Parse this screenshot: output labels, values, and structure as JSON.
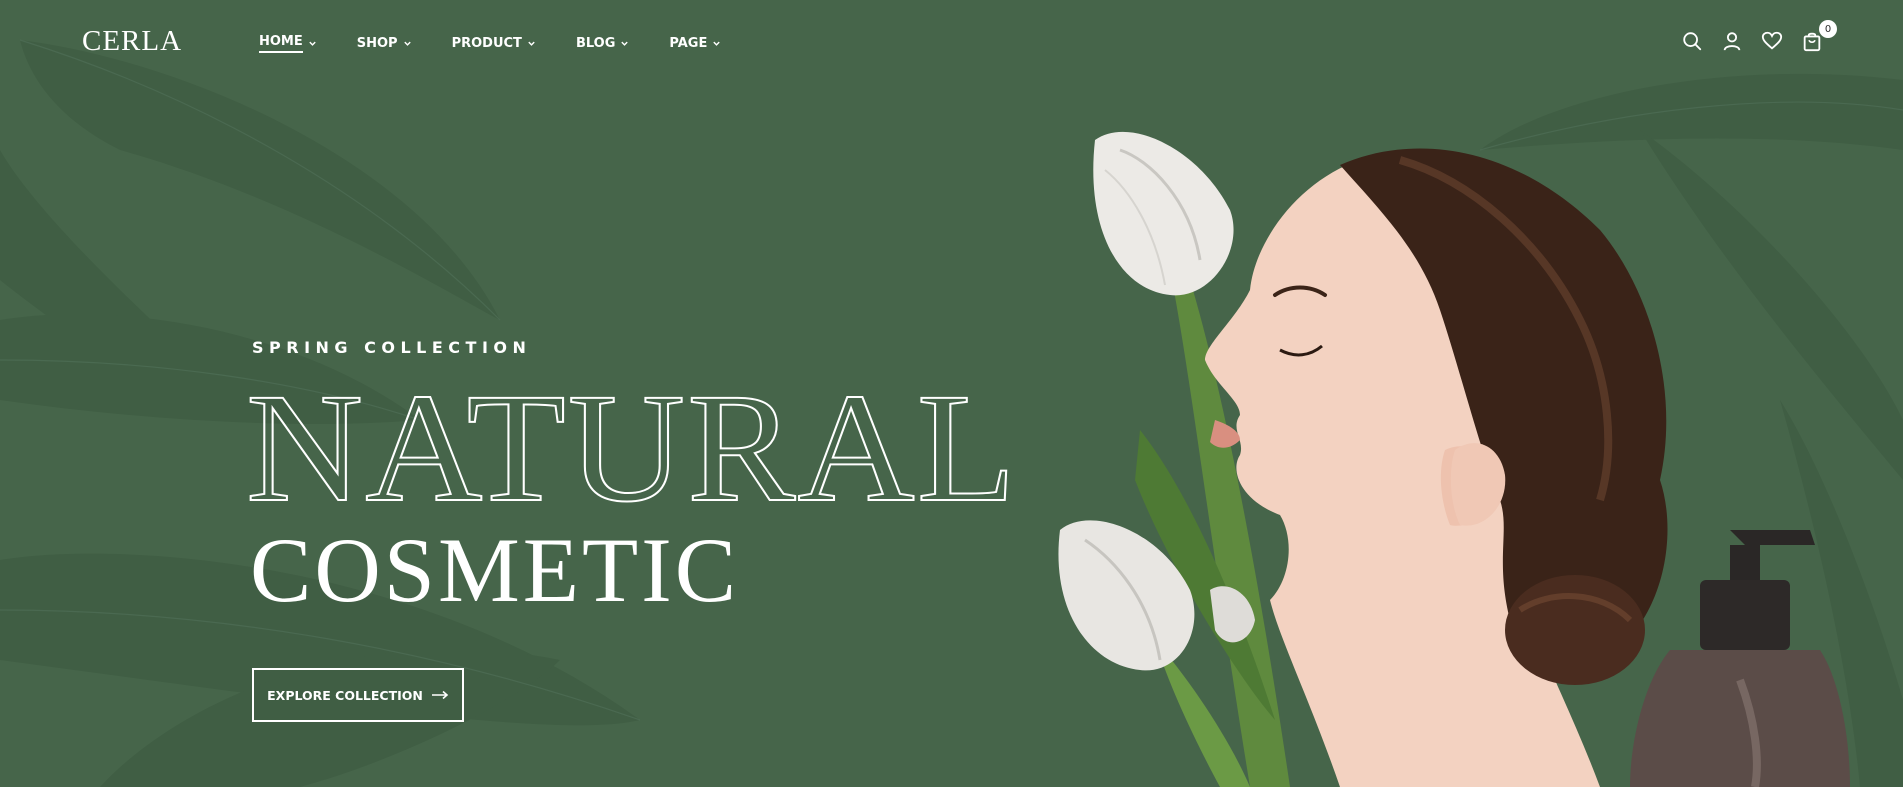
{
  "colors": {
    "background": "#46654a",
    "leaf": "#3f5d43",
    "text": "#ffffff"
  },
  "header": {
    "logo": "CERLA",
    "nav": [
      {
        "label": "HOME",
        "active": true
      },
      {
        "label": "SHOP"
      },
      {
        "label": "PRODUCT"
      },
      {
        "label": "BLOG"
      },
      {
        "label": "PAGE"
      }
    ],
    "icons": [
      "search-icon",
      "user-icon",
      "heart-icon",
      "cart-icon"
    ],
    "cart_count": "0"
  },
  "hero": {
    "kicker": "SPRING COLLECTION",
    "headline_1": "NATURAL",
    "headline_2": "COSMETIC",
    "cta_label": "EXPLORE COLLECTION"
  }
}
